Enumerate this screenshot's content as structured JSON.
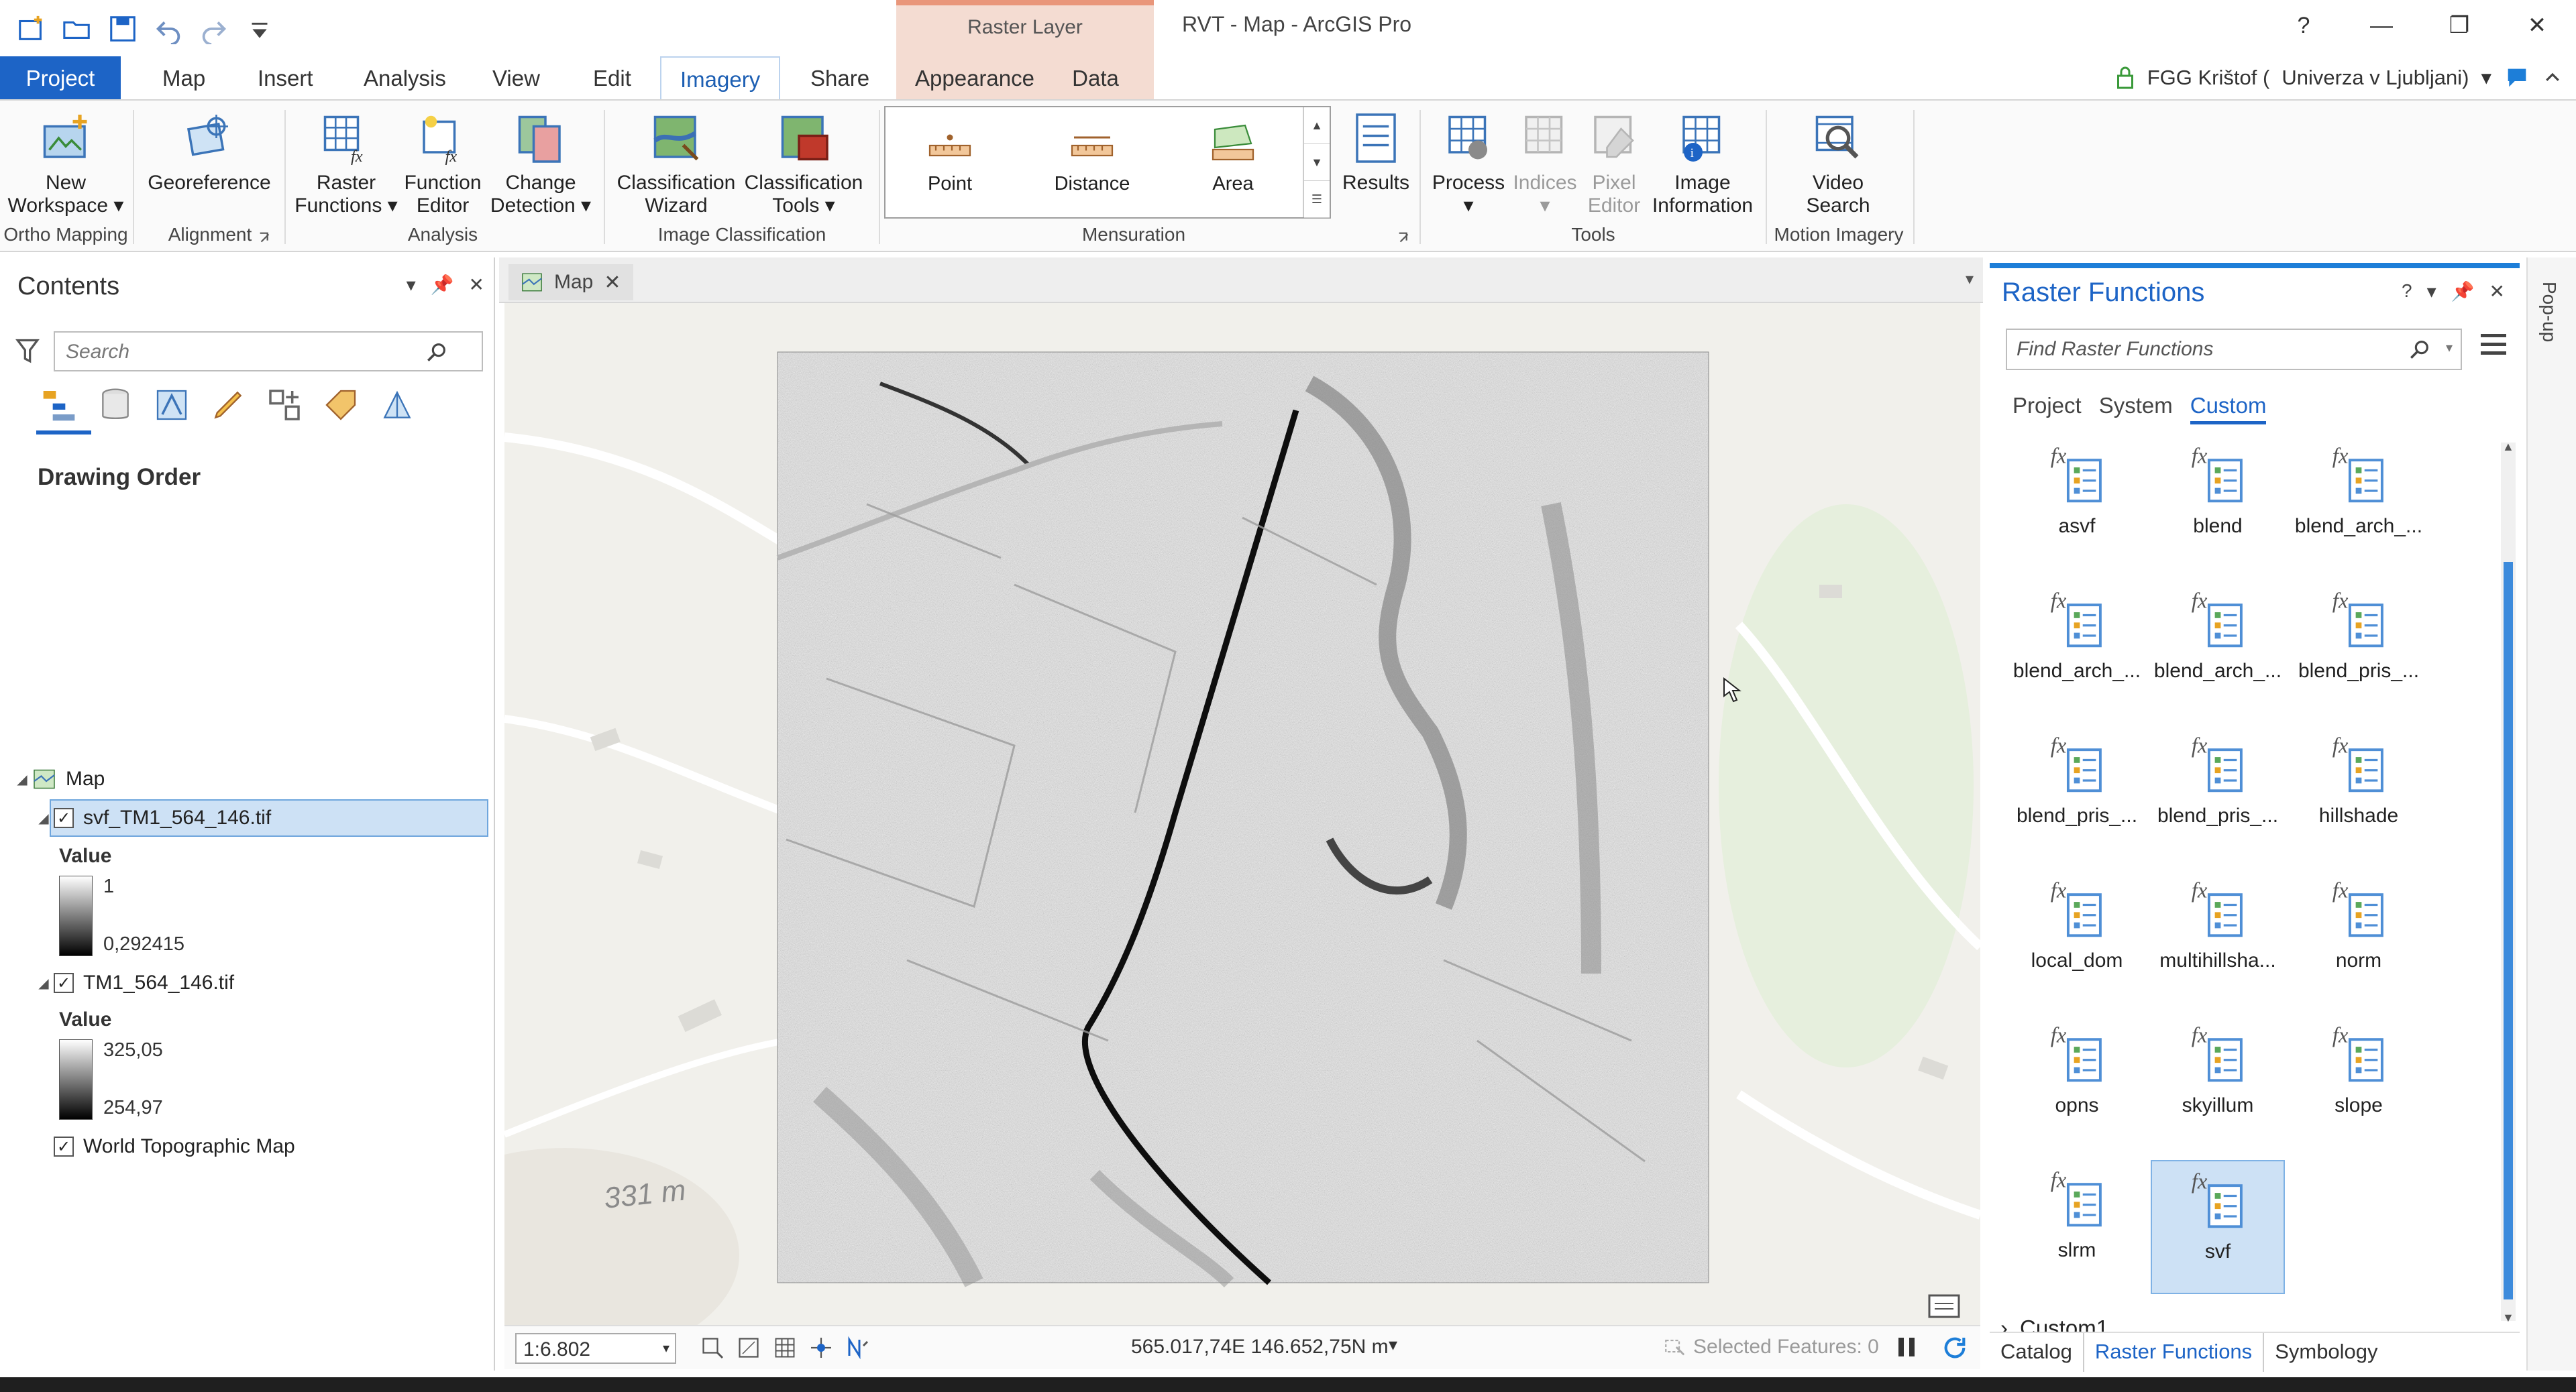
{
  "window": {
    "title": "RVT - Map - ArcGIS Pro",
    "context_header": "Raster Layer",
    "help": "?",
    "minimize": "—",
    "restore": "❐",
    "close": "✕"
  },
  "tabs": {
    "project": "Project",
    "map": "Map",
    "insert": "Insert",
    "analysis": "Analysis",
    "view": "View",
    "edit": "Edit",
    "imagery": "Imagery",
    "share": "Share",
    "appearance": "Appearance",
    "data": "Data"
  },
  "user": {
    "name": "FGG Krištof (",
    "org": "Univerza v Ljubljani)",
    "org_caret": "▾"
  },
  "ribbon": {
    "new_workspace_1": "New",
    "new_workspace_2": "Workspace ▾",
    "georeference": "Georeference",
    "raster_functions_1": "Raster",
    "raster_functions_2": "Functions ▾",
    "function_editor_1": "Function",
    "function_editor_2": "Editor",
    "change_detection_1": "Change",
    "change_detection_2": "Detection ▾",
    "classification_wizard_1": "Classification",
    "classification_wizard_2": "Wizard",
    "classification_tools_1": "Classification",
    "classification_tools_2": "Tools ▾",
    "point": "Point",
    "distance": "Distance",
    "area": "Area",
    "results": "Results",
    "process": "Process",
    "indices": "Indices",
    "pixel_editor_1": "Pixel",
    "pixel_editor_2": "Editor",
    "image_information_1": "Image",
    "image_information_2": "Information",
    "video_search_1": "Video",
    "video_search_2": "Search",
    "groups": {
      "ortho_mapping": "Ortho Mapping",
      "alignment": "Alignment",
      "analysis": "Analysis",
      "image_classification": "Image Classification",
      "mensuration": "Mensuration",
      "tools": "Tools",
      "motion_imagery": "Motion Imagery"
    }
  },
  "contents": {
    "title": "Contents",
    "search_placeholder": "Search",
    "drawing_order": "Drawing Order",
    "map_node": "Map",
    "layer1": {
      "name": "svf_TM1_564_146.tif",
      "value_label": "Value",
      "max": "1",
      "min": "0,292415"
    },
    "layer2": {
      "name": "TM1_564_146.tif",
      "value_label": "Value",
      "max": "325,05",
      "min": "254,97"
    },
    "basemap": "World Topographic Map"
  },
  "map": {
    "tab_label": "Map",
    "elevation_label": "331 m",
    "scale": "1:6.802",
    "coordinates": "565.017,74E 146.652,75N m",
    "selected_features": "Selected Features: 0"
  },
  "raster_functions": {
    "title": "Raster Functions",
    "search_placeholder": "Find Raster Functions",
    "subtabs": [
      "Project",
      "System",
      "Custom"
    ],
    "functions": [
      "asvf",
      "blend",
      "blend_arch_...",
      "blend_arch_...",
      "blend_arch_...",
      "blend_pris_...",
      "blend_pris_...",
      "blend_pris_...",
      "hillshade",
      "local_dom",
      "multihillsha...",
      "norm",
      "opns",
      "skyillum",
      "slope",
      "slrm",
      "svf"
    ],
    "custom_group": "Custom1"
  },
  "bottom_tabs": [
    "Catalog",
    "Raster Functions",
    "Symbology"
  ],
  "popup_label": "Pop-up",
  "colors": {
    "accent": "#1d64c6",
    "context_tab": "#f4dcd2",
    "selection": "#cde1f5"
  }
}
